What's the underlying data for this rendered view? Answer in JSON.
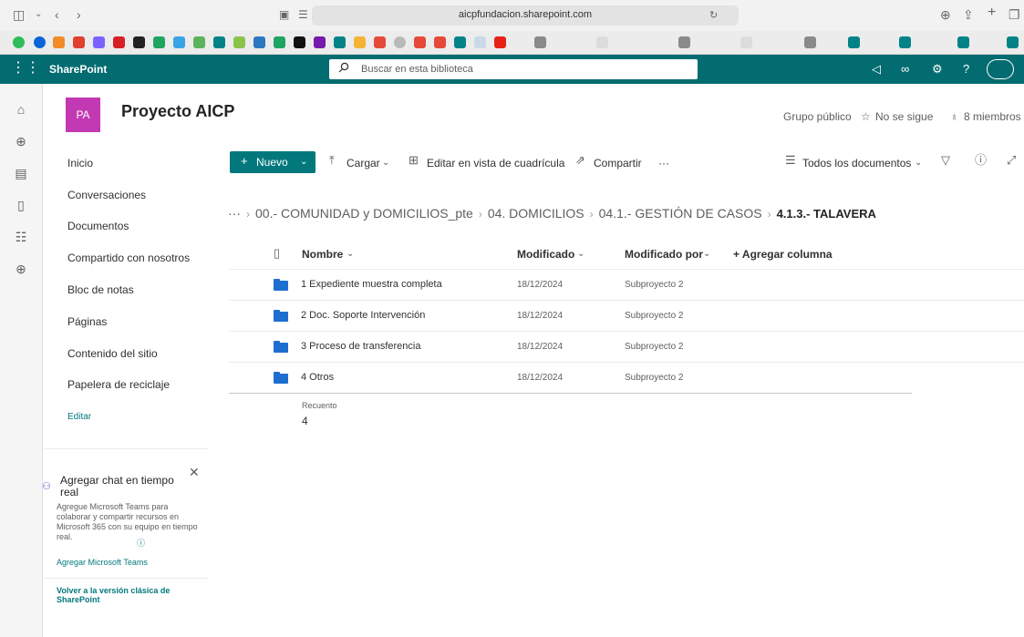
{
  "browser": {
    "url": "aicpfundacion.sharepoint.com"
  },
  "suite": {
    "brand": "SharePoint",
    "search_placeholder": "Buscar en esta biblioteca",
    "help_label": "?"
  },
  "site": {
    "logo_initials": "PA",
    "title": "Proyecto AICP",
    "group_type": "Grupo público",
    "follow_label": "No se sigue",
    "members_label": "8 miembros"
  },
  "nav": {
    "items": [
      "Inicio",
      "Conversaciones",
      "Documentos",
      "Compartido con nosotros",
      "Bloc de notas",
      "Páginas",
      "Contenido del sitio",
      "Papelera de reciclaje"
    ],
    "edit_label": "Editar"
  },
  "teams_card": {
    "title": "Agregar chat en tiempo real",
    "body": "Agregue Microsoft Teams para colaborar y compartir recursos en Microsoft 365 con su equipo en tiempo real.",
    "link": "Agregar Microsoft Teams"
  },
  "classic_link": "Volver a la versión clásica de SharePoint",
  "command_bar": {
    "new_label": "Nuevo",
    "upload_label": "Cargar",
    "grid_label": "Editar en vista de cuadrícula",
    "share_label": "Compartir",
    "more_label": "···",
    "view_label": "Todos los documentos"
  },
  "breadcrumb": {
    "ellipsis": "···",
    "items": [
      "00.- COMUNIDAD y DOMICILIOS_pte",
      "04. DOMICILIOS",
      "04.1.- GESTIÓN DE CASOS"
    ],
    "current": "4.1.3.- TALAVERA"
  },
  "table": {
    "columns": {
      "name": "Nombre",
      "modified": "Modificado",
      "modified_by": "Modificado por",
      "add_column": "+ Agregar columna"
    },
    "rows": [
      {
        "name": "1 Expediente muestra completa",
        "modified": "18/12/2024",
        "modified_by": "Subproyecto 2"
      },
      {
        "name": "2  Doc. Soporte Intervención",
        "modified": "18/12/2024",
        "modified_by": "Subproyecto 2"
      },
      {
        "name": "3 Proceso de transferencia",
        "modified": "18/12/2024",
        "modified_by": "Subproyecto 2"
      },
      {
        "name": "4 Otros",
        "modified": "18/12/2024",
        "modified_by": "Subproyecto 2"
      }
    ],
    "count_label": "Recuento",
    "count_value": "4"
  },
  "colors": {
    "suite_bar": "#036c70",
    "accent": "#03787c",
    "site_logo": "#c239b3",
    "folder": "#1e6ecf"
  },
  "icons": {
    "favorites": [
      "green-circle",
      "blue-circle",
      "orange-logo",
      "red-logo",
      "multicolor-logo",
      "netflix-logo",
      "amazon-logo",
      "drive-logo",
      "sharepoint-logo",
      "notion-logo",
      "opencart-logo",
      "youtube-logo"
    ]
  }
}
